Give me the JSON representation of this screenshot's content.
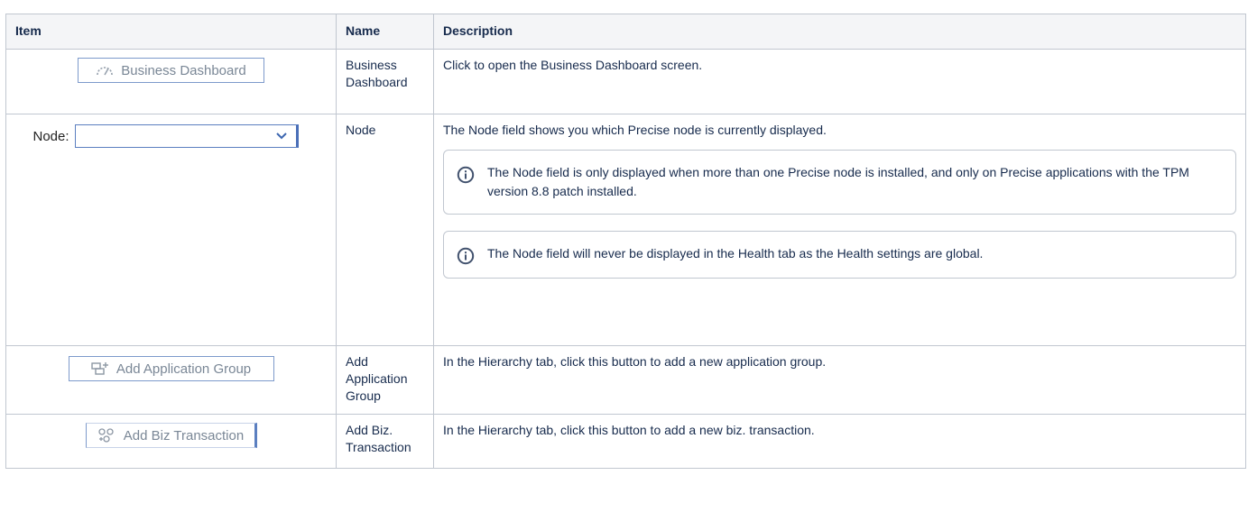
{
  "table": {
    "headers": {
      "item": "Item",
      "name": "Name",
      "description": "Description"
    },
    "rows": [
      {
        "item_button_label": "Business Dashboard",
        "item_icon": "gauge-icon",
        "name": "Business Dashboard",
        "description": "Click to open the Business Dashboard screen."
      },
      {
        "item_label": "Node:",
        "item_select_value": "",
        "name": "Node",
        "description": "The Node field shows you which Precise node is currently displayed.",
        "info_panels": [
          "The Node field is only displayed when more than one Precise node is installed, and only on Precise applications with the TPM version 8.8 patch installed.",
          "The Node field will never be displayed in the Health tab as the Health settings are global."
        ]
      },
      {
        "item_button_label": "Add Application Group",
        "item_icon": "add-group-icon",
        "name": "Add Application Group",
        "description": "In the Hierarchy tab, click this button to add a new application group."
      },
      {
        "item_button_label": "Add Biz Transaction",
        "item_icon": "add-transaction-icon",
        "name": "Add Biz. Transaction",
        "description": "In the Hierarchy tab, click this button to add a new biz. transaction."
      }
    ]
  },
  "colors": {
    "border": "#c1c7d0",
    "header_bg": "#f4f5f7",
    "button_border": "#5b7fc0",
    "button_text": "#7a8796",
    "info_icon": "#42526e"
  }
}
